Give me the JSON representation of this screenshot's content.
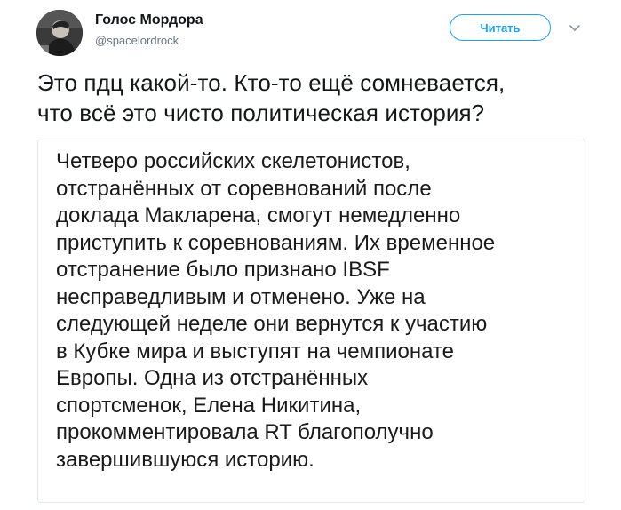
{
  "tweet": {
    "author": {
      "display_name": "Голос Мордора",
      "username": "@spacelordrock",
      "avatar_icon": "user-avatar-icon"
    },
    "follow_button_label": "Читать",
    "more_icon": "chevron-down-icon",
    "text": "Это пдц какой-то. Кто-то ещё сомневается,\nчто всё это чисто политическая история?",
    "media": {
      "text": "Четверо российских скелетонистов,\nотстранённых от соревнований после\nдоклада Макларена, смогут немедленно\nприступить к соревнованиям. Их временное\nотстранение было признано IBSF\nнесправедливым и отменено. Уже на\nследующей неделе они вернутся к участию\nв Кубке мира и выступят на чемпионате\nЕвропы. Одна из отстранённых\nспортсменок, Елена Никитина,\nпрокомментировала RT благополучно\nзавершившуюся историю."
    }
  },
  "colors": {
    "accent": "#1da1f2",
    "text_primary": "#14171a",
    "text_secondary": "#657786",
    "border": "#e1e8ed"
  }
}
